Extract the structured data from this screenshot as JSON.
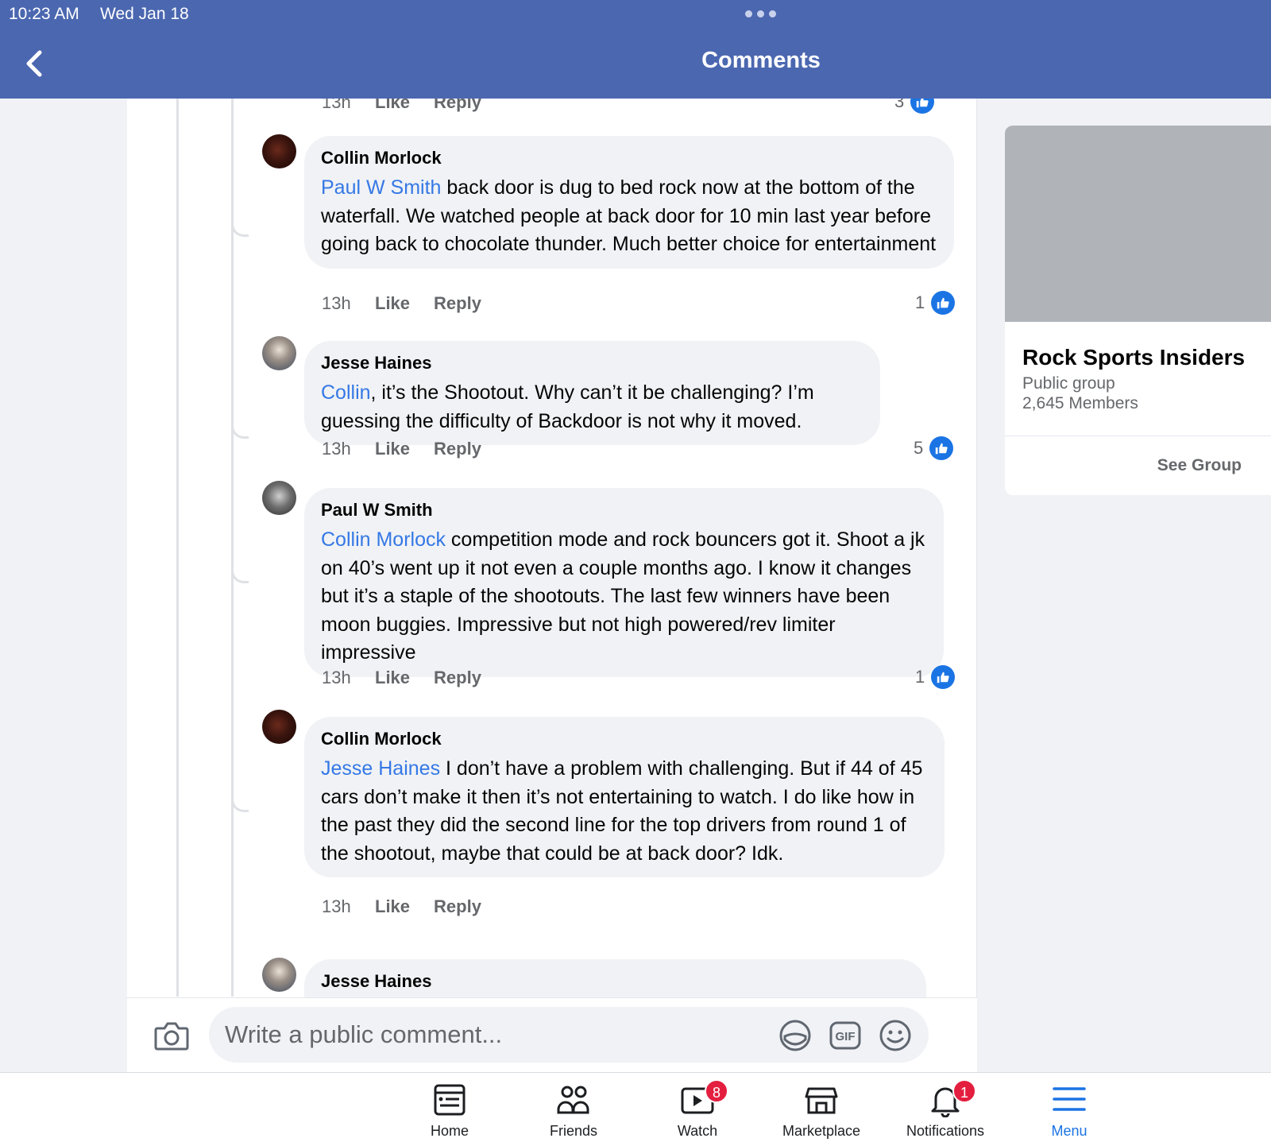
{
  "status_bar": {
    "time": "10:23 AM",
    "date": "Wed Jan 18"
  },
  "header": {
    "title": "Comments"
  },
  "top_partial": {
    "time": "13h",
    "like": "Like",
    "reply": "Reply",
    "reactions": "3"
  },
  "comments": [
    {
      "author": "Collin Morlock",
      "mention": "Paul W Smith",
      "text": " back door is dug to bed rock now at the bottom of the waterfall. We watched people at back door for 10 min last year before going back to chocolate thunder. Much better choice for entertainment",
      "time": "13h",
      "like": "Like",
      "reply": "Reply",
      "reactions": "1"
    },
    {
      "author": "Jesse Haines",
      "mention": "Collin",
      "text": ", it’s the Shootout. Why can’t it be challenging? I’m guessing the difficulty of Backdoor is not why it moved.",
      "time": "13h",
      "like": "Like",
      "reply": "Reply",
      "reactions": "5"
    },
    {
      "author": "Paul W Smith",
      "mention": "Collin Morlock",
      "text": " competition mode and rock bouncers got it. Shoot a jk on 40’s went up it not even a couple months ago. I know it changes but it’s a staple of the shootouts.  The last few winners have been moon buggies. Impressive but not high powered/rev limiter impressive",
      "time": "13h",
      "like": "Like",
      "reply": "Reply",
      "reactions": "1"
    },
    {
      "author": "Collin Morlock",
      "mention": "Jesse Haines",
      "text": " I don’t have a problem with challenging. But if 44 of 45 cars don’t make it then it’s not entertaining to watch. I do like how in the past they did the second line for the top drivers from round 1 of the shootout, maybe that could be at back door? Idk.",
      "time": "13h",
      "like": "Like",
      "reply": "Reply"
    },
    {
      "author": "Jesse Haines"
    }
  ],
  "composer": {
    "placeholder": "Write a public comment...",
    "icons": [
      "camera-icon",
      "sticker-icon",
      "gif-icon",
      "emoji-icon"
    ]
  },
  "group": {
    "name": "Rock Sports Insiders",
    "type": "Public group",
    "members": "2,645 Members",
    "action": "See Group"
  },
  "tabs": [
    {
      "label": "Home",
      "icon": "home-icon"
    },
    {
      "label": "Friends",
      "icon": "friends-icon"
    },
    {
      "label": "Watch",
      "icon": "watch-icon",
      "badge": "8"
    },
    {
      "label": "Marketplace",
      "icon": "marketplace-icon"
    },
    {
      "label": "Notifications",
      "icon": "bell-icon",
      "badge": "1"
    },
    {
      "label": "Menu",
      "icon": "menu-icon",
      "active": true
    }
  ],
  "colors": {
    "header": "#4b67b0",
    "mention": "#3578e5",
    "like_badge": "#1b74e4",
    "badge_red": "#e41e3f"
  }
}
